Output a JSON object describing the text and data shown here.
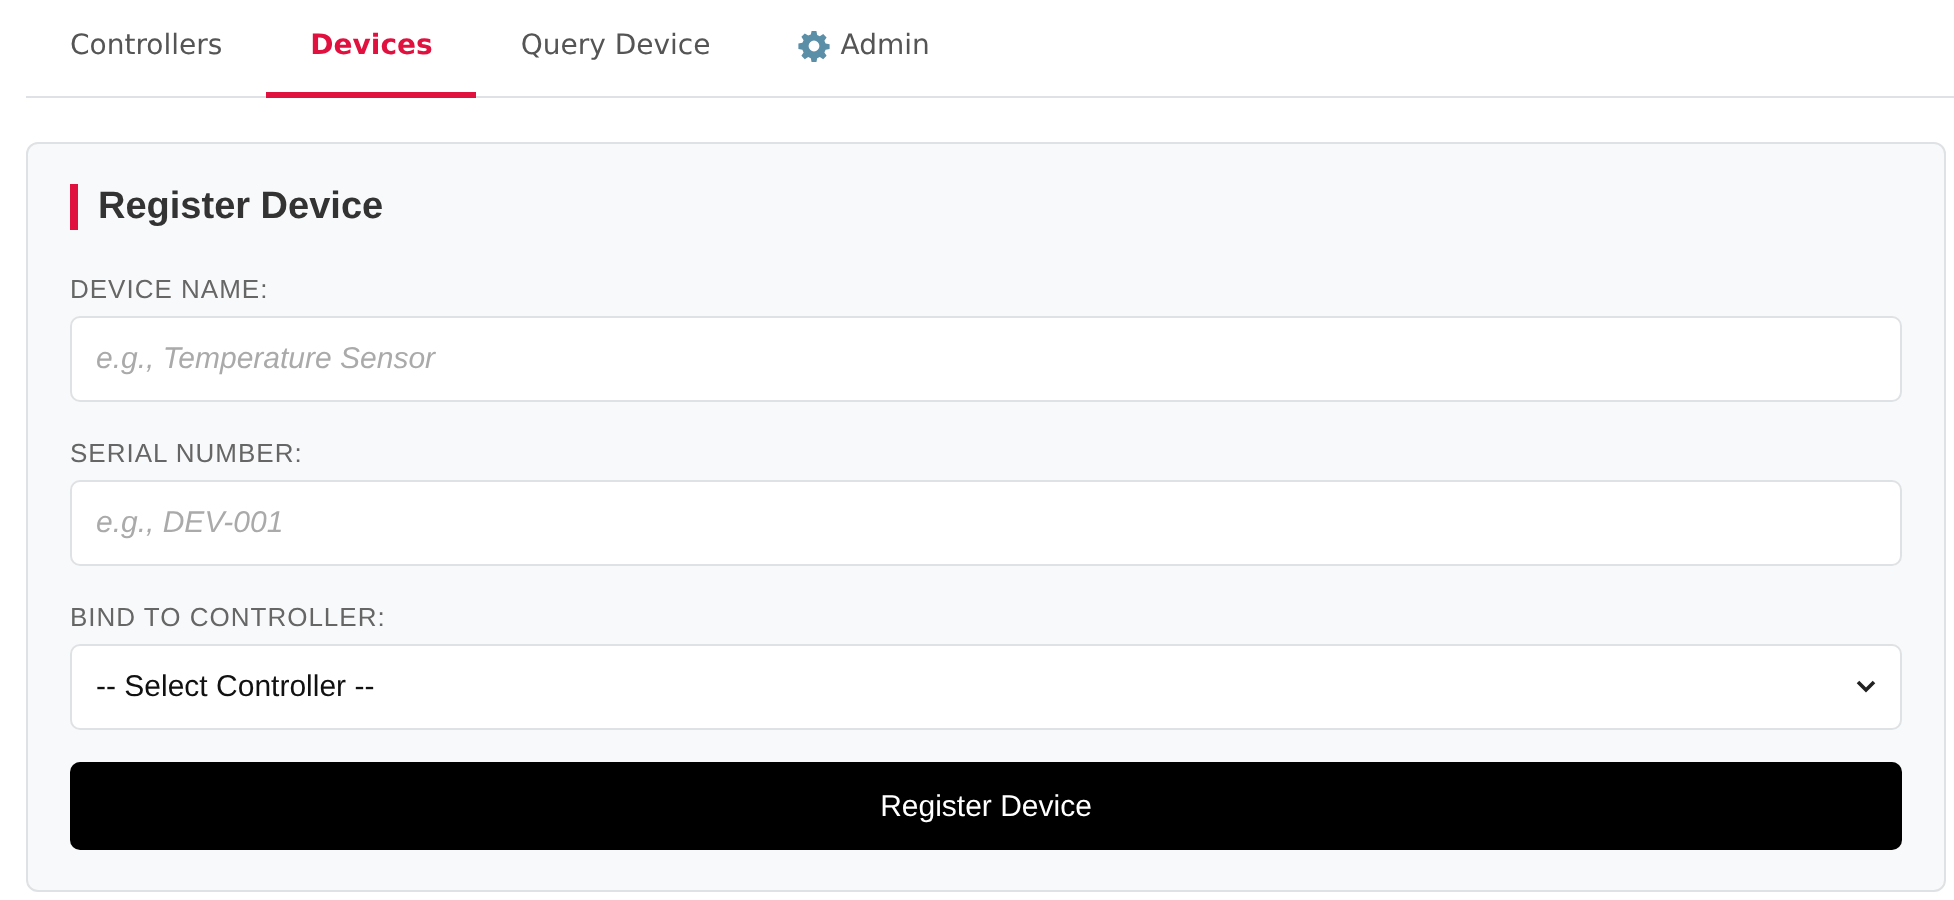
{
  "tabs": [
    {
      "label": "Controllers",
      "selected": false,
      "kind": "plain"
    },
    {
      "label": "Devices",
      "selected": true,
      "kind": "plain"
    },
    {
      "label": "Query Device",
      "selected": false,
      "kind": "plain"
    },
    {
      "label": "Admin",
      "selected": false,
      "kind": "gear"
    }
  ],
  "card": {
    "title": "Register Device",
    "fields": [
      {
        "label": "DEVICE NAME:",
        "kind": "text",
        "placeholder": "e.g., Temperature Sensor"
      },
      {
        "label": "SERIAL NUMBER:",
        "kind": "text",
        "placeholder": "e.g., DEV-001"
      },
      {
        "label": "BIND TO CONTROLLER:",
        "kind": "select",
        "value": "-- Select Controller --"
      }
    ],
    "button": "Register Device"
  }
}
